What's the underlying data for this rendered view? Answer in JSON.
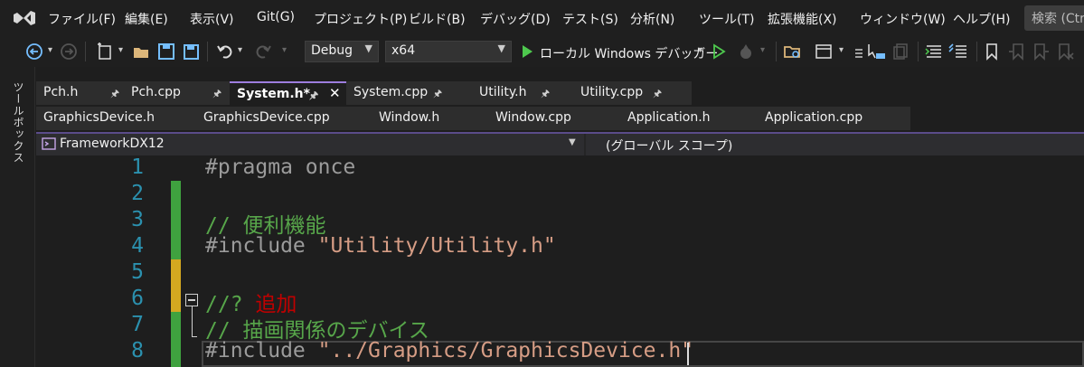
{
  "menu": {
    "items": [
      "ファイル(F)",
      "編集(E)",
      "表示(V)",
      "Git(G)",
      "プロジェクト(P)",
      "ビルド(B)",
      "デバッグ(D)",
      "テスト(S)",
      "分析(N)",
      "ツール(T)",
      "拡張機能(X)",
      "ウィンドウ(W)",
      "ヘルプ(H)"
    ],
    "search_placeholder": "検索 (Ctrl+Q)"
  },
  "toolbar": {
    "configuration": "Debug",
    "platform": "x64",
    "debugger_label": "ローカル Windows デバッガー"
  },
  "side_panel": {
    "label": "ツールボックス"
  },
  "tabs_row1": [
    {
      "label": "Pch.h",
      "pinned": true,
      "active": false
    },
    {
      "label": "Pch.cpp",
      "pinned": true,
      "active": false
    },
    {
      "label": "System.h*",
      "pinned": true,
      "active": true
    },
    {
      "label": "System.cpp",
      "pinned": true,
      "active": false
    },
    {
      "label": "Utility.h",
      "pinned": true,
      "active": false
    },
    {
      "label": "Utility.cpp",
      "pinned": true,
      "active": false
    }
  ],
  "tabs_row2": [
    {
      "label": "GraphicsDevice.h"
    },
    {
      "label": "GraphicsDevice.cpp"
    },
    {
      "label": "Window.h"
    },
    {
      "label": "Window.cpp"
    },
    {
      "label": "Application.h"
    },
    {
      "label": "Application.cpp"
    }
  ],
  "navbar": {
    "project": "FrameworkDX12",
    "scope": "(グローバル スコープ)"
  },
  "editor": {
    "lines": [
      {
        "num": "1",
        "parts": [
          {
            "t": "#pragma once",
            "c": "kw"
          }
        ]
      },
      {
        "num": "2",
        "parts": []
      },
      {
        "num": "3",
        "parts": [
          {
            "t": "// 便利機能",
            "c": "cmt"
          }
        ]
      },
      {
        "num": "4",
        "parts": [
          {
            "t": "#include ",
            "c": "kw"
          },
          {
            "t": "\"Utility/Utility.h\"",
            "c": "str"
          }
        ]
      },
      {
        "num": "5",
        "parts": []
      },
      {
        "num": "6",
        "parts": [
          {
            "t": "//? ",
            "c": "cmt"
          },
          {
            "t": "追加",
            "c": "todo"
          }
        ]
      },
      {
        "num": "7",
        "parts": [
          {
            "t": "// 描画関係のデバイス",
            "c": "cmt"
          }
        ]
      },
      {
        "num": "8",
        "parts": [
          {
            "t": "#include ",
            "c": "kw"
          },
          {
            "t": "\"../Graphics/GraphicsDevice.h\"",
            "c": "str"
          }
        ]
      }
    ],
    "colors": {
      "line_number": "#2b91af",
      "comment": "#57a64a",
      "string": "#d69d85",
      "directive": "#9b9b9b",
      "todo": "#c00000",
      "change_saved": "#3fa23f",
      "change_unsaved": "#d4a820"
    }
  }
}
